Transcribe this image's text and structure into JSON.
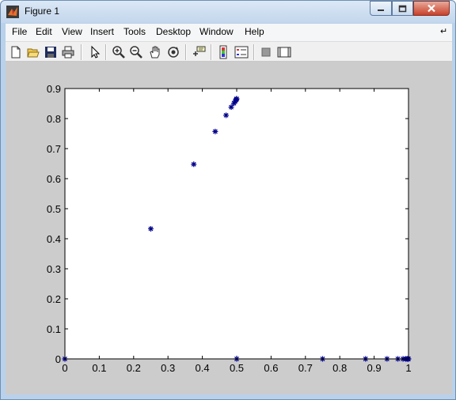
{
  "window": {
    "title": "Figure 1"
  },
  "menu": {
    "items": [
      "File",
      "Edit",
      "View",
      "Insert",
      "Tools",
      "Desktop",
      "Window",
      "Help"
    ]
  },
  "toolbar": {
    "buttons": [
      "new-figure",
      "open-file",
      "save-figure",
      "print-figure",
      "edit-plot",
      "zoom-in",
      "zoom-out",
      "pan",
      "rotate-3d",
      "data-cursor",
      "insert-colorbar",
      "insert-legend",
      "hide-plot-tools",
      "show-plot-tools"
    ]
  },
  "colors": {
    "marker": "#00008b",
    "figure_bg": "#cccccc",
    "axes_bg": "#ffffff"
  },
  "chart_data": {
    "type": "scatter",
    "marker": "*",
    "xlim": [
      0,
      1
    ],
    "ylim": [
      0,
      0.9
    ],
    "xticks": [
      "0",
      "0.1",
      "0.2",
      "0.3",
      "0.4",
      "0.5",
      "0.6",
      "0.7",
      "0.8",
      "0.9",
      "1"
    ],
    "yticks": [
      "0",
      "0.1",
      "0.2",
      "0.3",
      "0.4",
      "0.5",
      "0.6",
      "0.7",
      "0.8",
      "0.9"
    ],
    "grid": false,
    "title": "",
    "xlabel": "",
    "ylabel": "",
    "points": [
      [
        0,
        0
      ],
      [
        0.25,
        0.433
      ],
      [
        0.375,
        0.648
      ],
      [
        0.4375,
        0.757
      ],
      [
        0.469,
        0.811
      ],
      [
        0.484,
        0.838
      ],
      [
        0.492,
        0.851
      ],
      [
        0.496,
        0.858
      ],
      [
        0.498,
        0.862
      ],
      [
        0.499,
        0.864
      ],
      [
        0.4995,
        0.865
      ],
      [
        0.4998,
        0.866
      ],
      [
        0.5,
        0
      ],
      [
        0.75,
        0
      ],
      [
        0.875,
        0
      ],
      [
        0.9375,
        0
      ],
      [
        0.969,
        0
      ],
      [
        0.984,
        0
      ],
      [
        0.992,
        0
      ],
      [
        0.996,
        0
      ],
      [
        0.998,
        0
      ],
      [
        0.999,
        0
      ],
      [
        1,
        0
      ]
    ]
  }
}
